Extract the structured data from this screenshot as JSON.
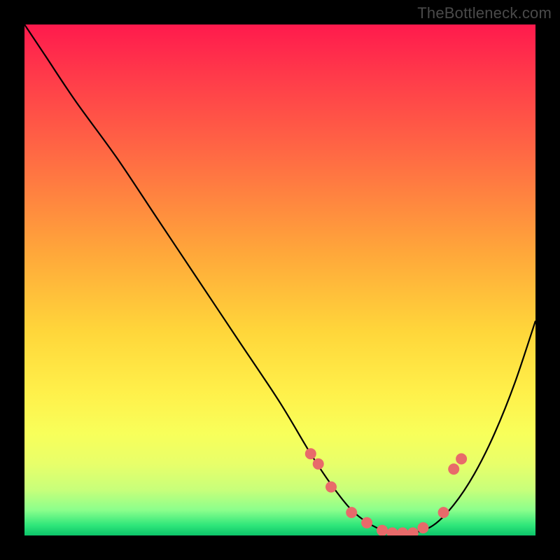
{
  "watermark": "TheBottleneck.com",
  "chart_data": {
    "type": "line",
    "title": "",
    "xlabel": "",
    "ylabel": "",
    "xlim": [
      0,
      100
    ],
    "ylim": [
      0,
      100
    ],
    "series": [
      {
        "name": "bottleneck-curve",
        "x": [
          0,
          4,
          10,
          18,
          26,
          34,
          42,
          50,
          56,
          60,
          64,
          68,
          72,
          76,
          80,
          84,
          88,
          92,
          96,
          100
        ],
        "y": [
          100,
          94,
          85,
          74,
          62,
          50,
          38,
          26,
          16,
          10,
          5,
          2,
          0.5,
          0.5,
          2,
          6,
          12,
          20,
          30,
          42
        ]
      }
    ],
    "markers": {
      "name": "highlight-points",
      "x": [
        56,
        57.5,
        60,
        64,
        67,
        70,
        72,
        74,
        76,
        78,
        82,
        84,
        85.5
      ],
      "y": [
        16,
        14,
        9.5,
        4.5,
        2.5,
        1,
        0.5,
        0.5,
        0.5,
        1.5,
        4.5,
        13,
        15
      ]
    },
    "gradient_stops": [
      {
        "pos": 0,
        "color": "#ff1a4d"
      },
      {
        "pos": 50,
        "color": "#ffd63a"
      },
      {
        "pos": 100,
        "color": "#0cc46a"
      }
    ]
  }
}
